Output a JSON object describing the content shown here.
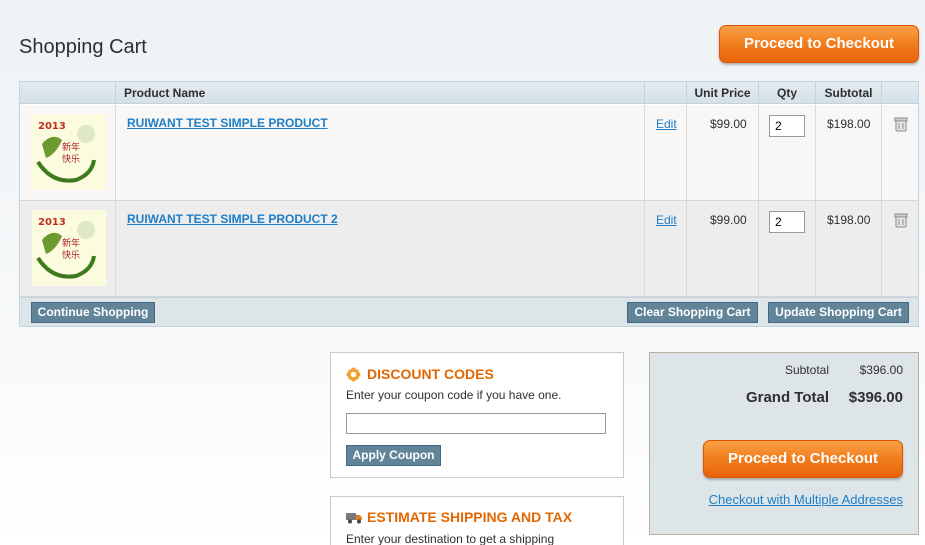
{
  "page": {
    "title": "Shopping Cart"
  },
  "checkout_button_label": "Proceed to Checkout",
  "table": {
    "headers": {
      "product_name": "Product Name",
      "unit_price": "Unit Price",
      "qty": "Qty",
      "subtotal": "Subtotal"
    },
    "rows": [
      {
        "name": "RUIWANT TEST SIMPLE PRODUCT",
        "edit": "Edit",
        "price": "$99.00",
        "qty": "2",
        "subtotal": "$198.00"
      },
      {
        "name": "RUIWANT TEST SIMPLE PRODUCT 2",
        "edit": "Edit",
        "price": "$99.00",
        "qty": "2",
        "subtotal": "$198.00"
      }
    ],
    "footer": {
      "continue": "Continue Shopping",
      "clear": "Clear Shopping Cart",
      "update": "Update Shopping Cart"
    }
  },
  "discount": {
    "title": "DISCOUNT CODES",
    "text": "Enter your coupon code if you have one.",
    "input_value": "",
    "button": "Apply Coupon"
  },
  "shipping": {
    "title": "ESTIMATE SHIPPING AND TAX",
    "text": "Enter your destination to get a shipping"
  },
  "totals": {
    "subtotal_label": "Subtotal",
    "subtotal_value": "$396.00",
    "grand_total_label": "Grand Total",
    "grand_total_value": "$396.00",
    "multi_address_link": "Checkout with Multiple Addresses"
  }
}
